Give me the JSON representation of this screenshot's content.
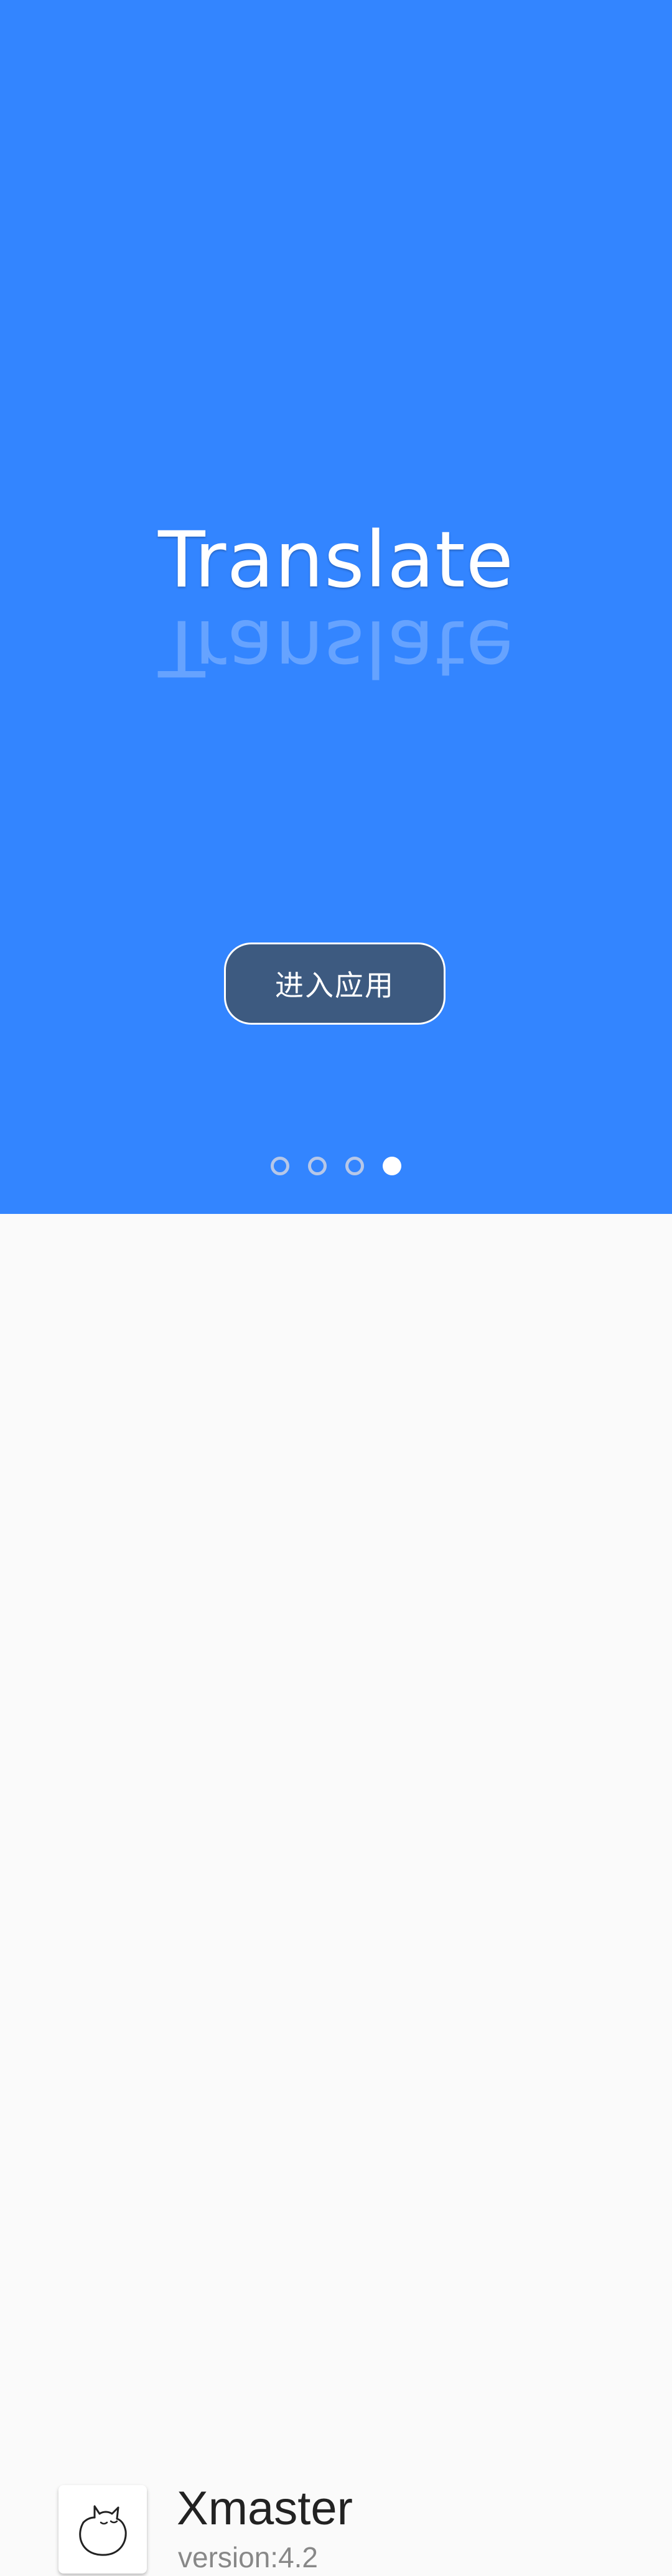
{
  "hero": {
    "headline": "Translate",
    "reflection": "Translate",
    "enter_button_label": "进入应用",
    "pager": {
      "total_pages": 4,
      "active_index": 3
    }
  },
  "footer": {
    "app_name": "Xmaster",
    "version": "version:4.2",
    "app_icon": "sleeping-cat-icon"
  },
  "colors": {
    "hero_background": "#3385ff",
    "button_background": "#3d5a80",
    "footer_background": "#fafafa"
  }
}
